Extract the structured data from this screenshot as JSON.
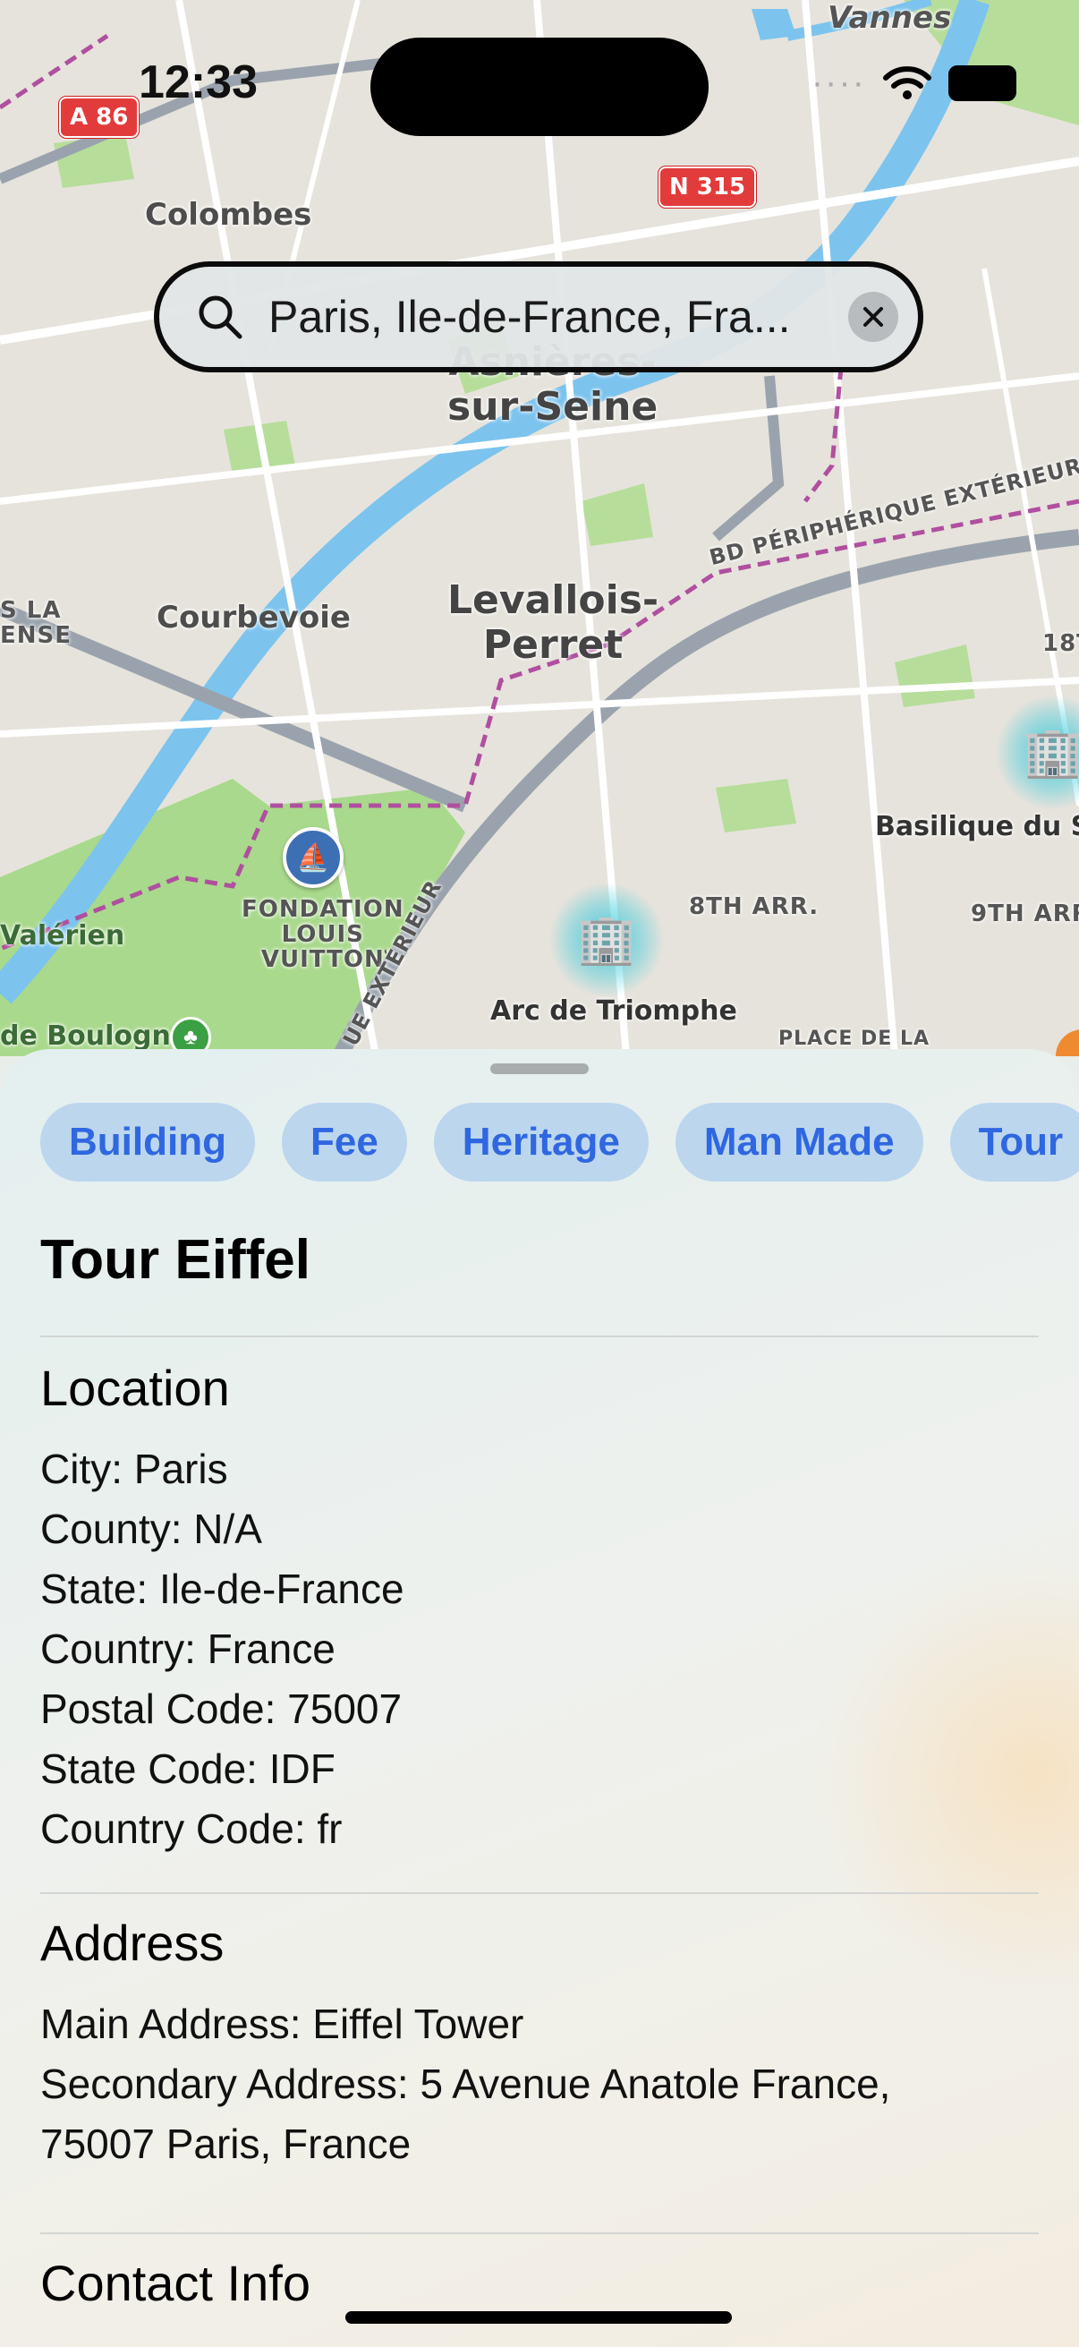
{
  "status_bar": {
    "time": "12:33",
    "signal": "····"
  },
  "map": {
    "labels": {
      "vannes": "Vannes",
      "colombes": "Colombes",
      "asnieres": "Asnières-\nsur-Seine",
      "levallois": "Levallois-\nPerret",
      "courbevoie": "Courbevoie",
      "la_defense": "S LA\nENSE",
      "valerien": "Valérien",
      "de_boulogne": "de Boulogne",
      "fondation": "FONDATION\nLOUIS\nVUITTON",
      "arc": "Arc de Triomphe",
      "basilique": "Basilique du Sa",
      "arr8": "8TH ARR.",
      "arr9": "9TH ARR",
      "arr18": "18T",
      "bd_peripherique": "BD PÉRIPHÉRIQUE EXTÉRIEUR",
      "bd_exterieur": "UE EXTÉRIEUR",
      "place": "PLACE DE LA"
    },
    "shields": {
      "a86": "A 86",
      "n315": "N 315"
    },
    "colors": {
      "water": "#7cc4ee",
      "park": "#a9d98c",
      "road": "#ffffff",
      "highway": "#9aa3ad",
      "boundary": "#b04fa0"
    }
  },
  "search": {
    "value": "Paris, Ile-de-France, Fra..."
  },
  "details": {
    "tags": [
      "Building",
      "Fee",
      "Heritage",
      "Man Made",
      "Tour"
    ],
    "title": "Tour Eiffel",
    "location": {
      "heading": "Location",
      "lines": [
        "City: Paris",
        "County: N/A",
        "State: Ile-de-France",
        "Country: France",
        "Postal Code: 75007",
        "State Code: IDF",
        "Country Code: fr"
      ]
    },
    "address": {
      "heading": "Address",
      "lines": [
        "Main Address: Eiffel Tower",
        "Secondary Address: 5 Avenue Anatole France,",
        "75007 Paris, France"
      ]
    },
    "contact": {
      "heading": "Contact Info"
    }
  },
  "colors": {
    "chip_bg": "#bcd6ee",
    "chip_text": "#2f67e0",
    "accent_glow": "#28c8dc"
  }
}
